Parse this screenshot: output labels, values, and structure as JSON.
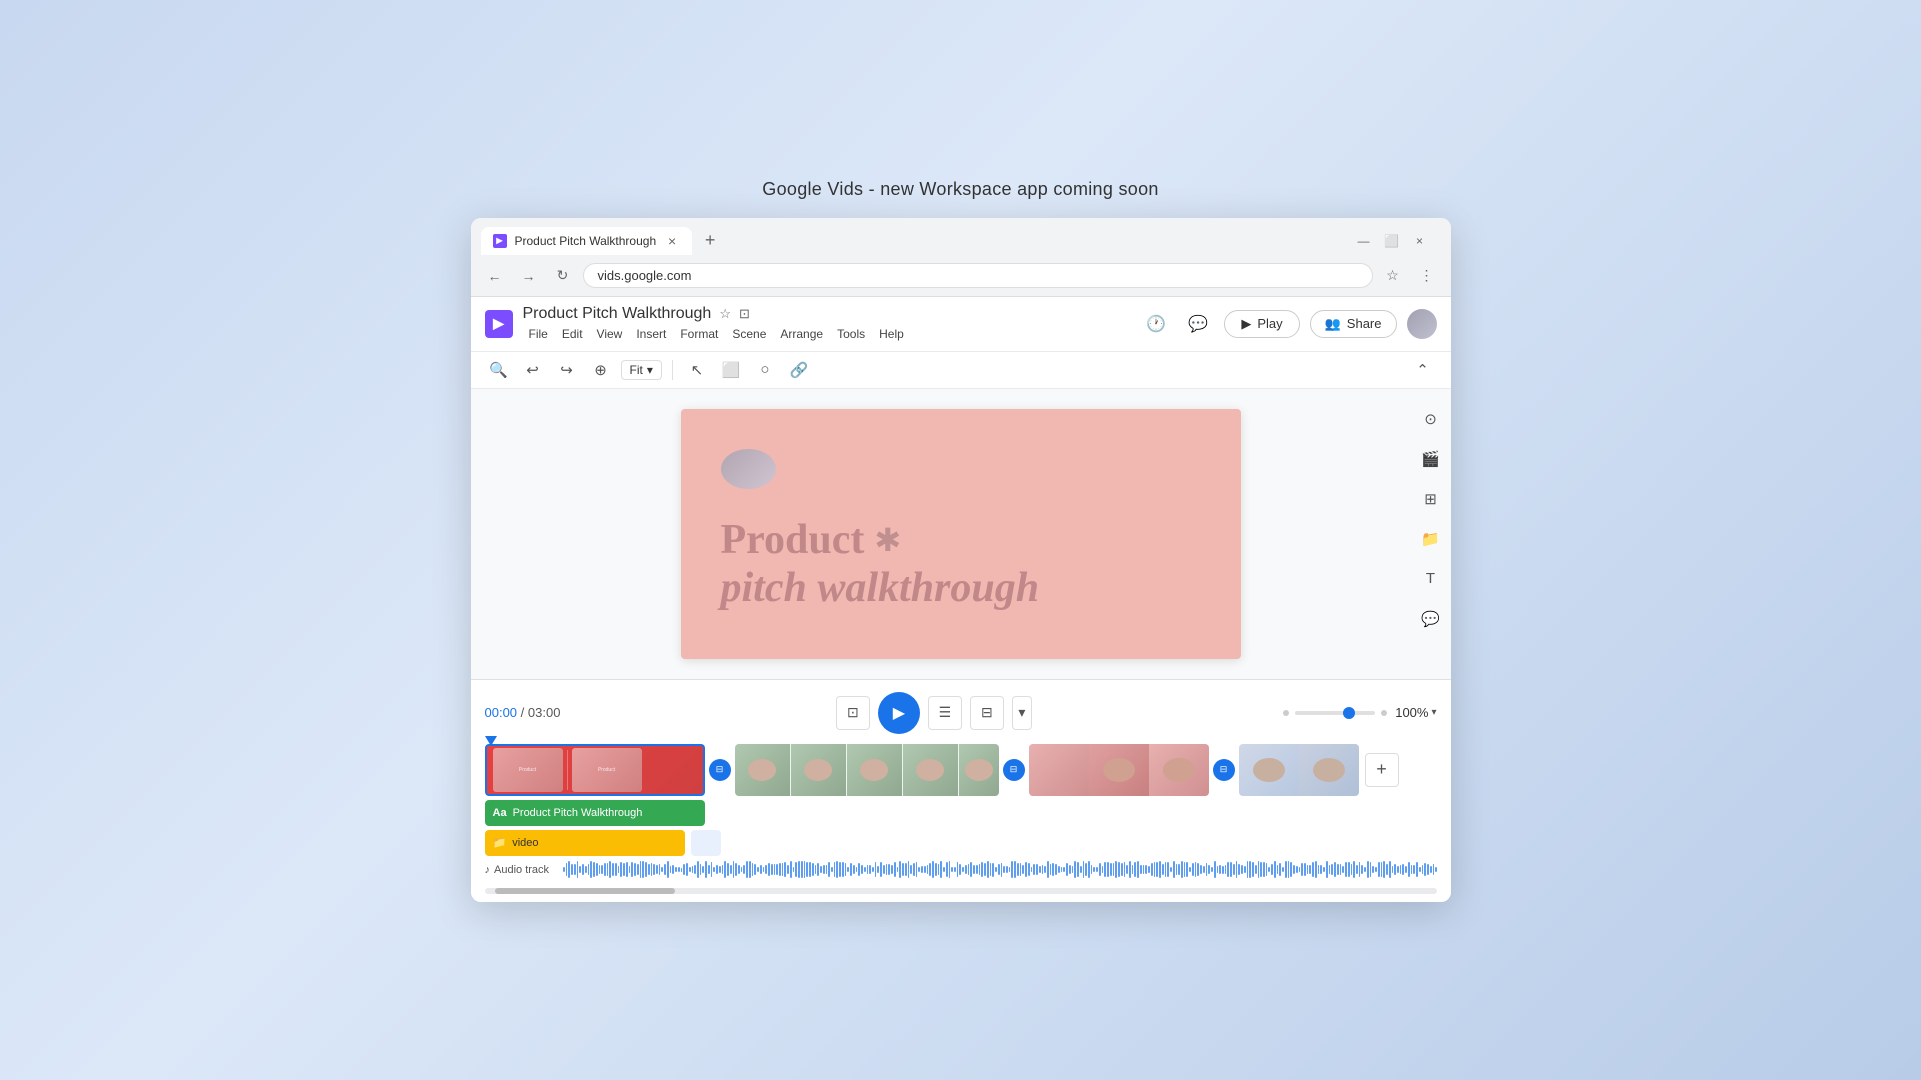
{
  "page": {
    "top_label": "Google Vids - new Workspace app coming soon",
    "browser": {
      "tab_title": "Product Pitch Walkthrough",
      "tab_close": "×",
      "tab_new": "+",
      "url": "vids.google.com",
      "win_minimize": "—",
      "win_maximize": "⬜",
      "win_close": "×"
    },
    "app": {
      "logo_letter": "▶",
      "title": "Product Pitch Walkthrough",
      "star_icon": "☆",
      "present_icon": "⊡",
      "menu": {
        "file": "File",
        "edit": "Edit",
        "view": "View",
        "insert": "Insert",
        "format": "Format",
        "scene": "Scene",
        "arrange": "Arrange",
        "tools": "Tools",
        "help": "Help"
      },
      "history_icon": "🕐",
      "comment_icon": "💬",
      "play_label": "Play",
      "share_label": "Share"
    },
    "toolbar": {
      "zoom_level": "Fit",
      "zoom_chevron": "▾"
    },
    "slide": {
      "text_line1": "Product *",
      "text_line2": "pitch walkthrough"
    },
    "timeline": {
      "current_time": "00:00",
      "separator": "/",
      "total_time": "03:00",
      "zoom_percent": "100%",
      "zoom_chevron": "▾",
      "tracks": {
        "green_label": "Product Pitch Walkthrough",
        "yellow_label": "video",
        "audio_label": "Audio track"
      },
      "add_clip": "+"
    }
  }
}
